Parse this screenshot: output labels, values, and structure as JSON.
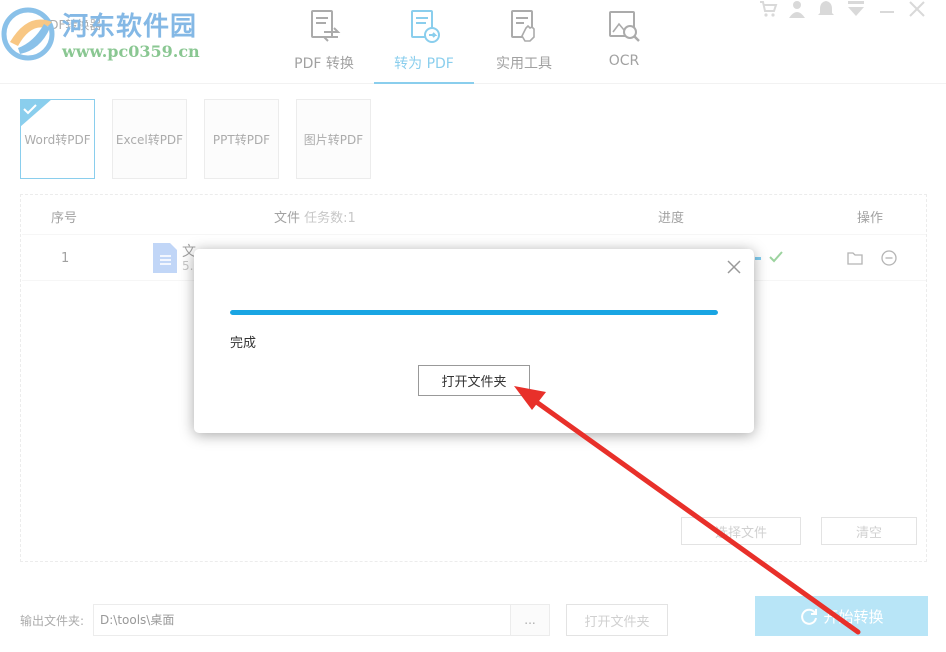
{
  "header": {
    "app_title": "PDF转换器",
    "watermark_name": "河东软件园",
    "watermark_url": "www.pc0359.cn",
    "tabs": [
      {
        "label": "PDF 转换",
        "icon": "pdf-convert-icon"
      },
      {
        "label": "转为 PDF",
        "icon": "to-pdf-icon",
        "active": true
      },
      {
        "label": "实用工具",
        "icon": "tools-icon"
      },
      {
        "label": "OCR",
        "icon": "ocr-icon"
      }
    ],
    "window_controls": [
      "cart-icon",
      "user-icon",
      "bell-icon",
      "dropdown-icon",
      "minimize-icon",
      "close-icon"
    ]
  },
  "subtabs": [
    {
      "label": "Word转PDF",
      "active": true
    },
    {
      "label": "Excel转PDF"
    },
    {
      "label": "PPT转PDF"
    },
    {
      "label": "图片转PDF"
    }
  ],
  "table": {
    "col_index": "序号",
    "col_file": "文件",
    "col_task_count": "任务数:1",
    "col_progress": "进度",
    "col_actions": "操作",
    "rows": [
      {
        "index": "1",
        "file_name": "文",
        "file_size": "5."
      }
    ]
  },
  "panel_buttons": {
    "select_files": "选择文件",
    "clear": "清空"
  },
  "output": {
    "label": "输出文件夹:",
    "path": "D:\\tools\\桌面",
    "browse": "...",
    "open_folder": "打开文件夹",
    "start": "开始转换"
  },
  "modal": {
    "progress": 1.0,
    "status": "完成",
    "open_folder": "打开文件夹"
  },
  "colors": {
    "accent": "#2ba6df",
    "progress": "#19a5e3",
    "start_button": "#7fd0f0",
    "arrow": "#e8302a",
    "check": "#4caf50"
  }
}
